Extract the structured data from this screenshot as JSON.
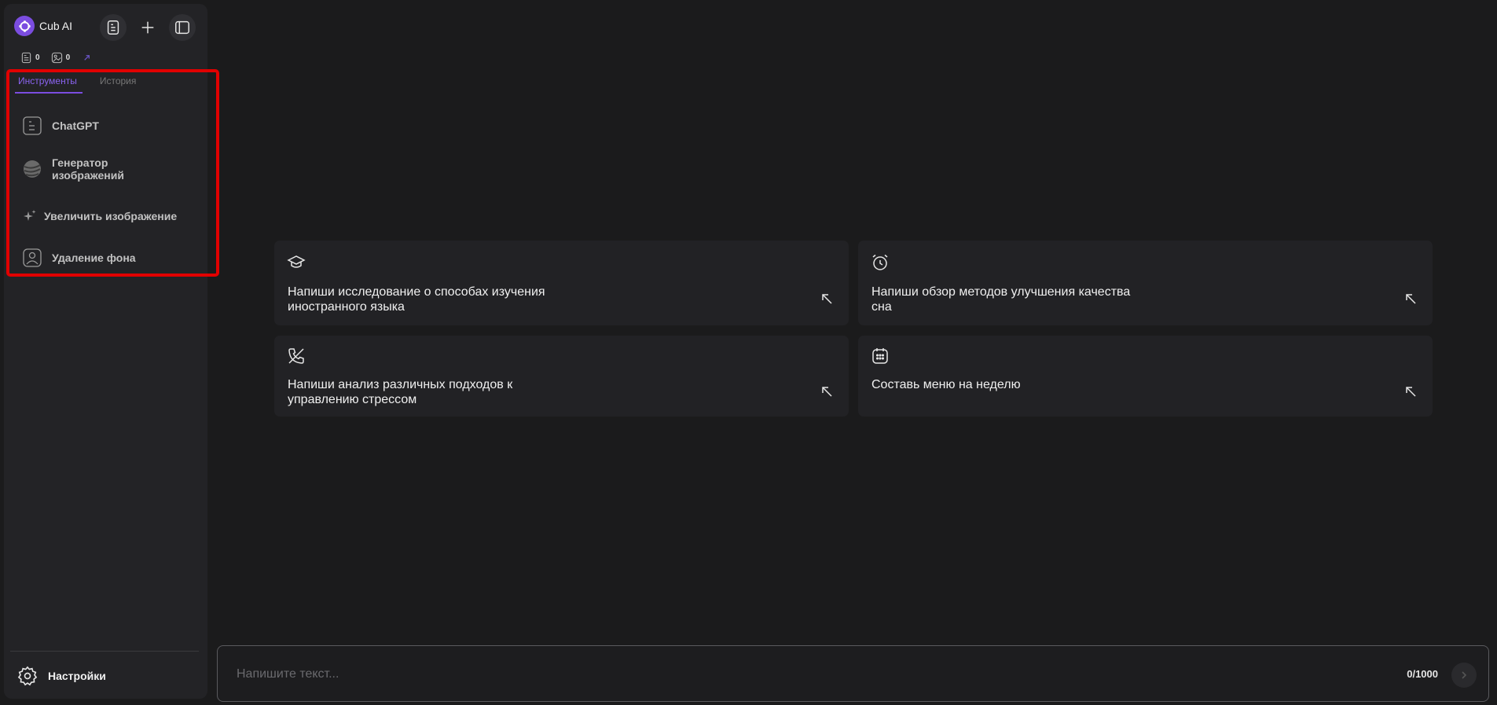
{
  "brand": {
    "name": "Cub AI"
  },
  "counters": [
    {
      "icon": "document-icon",
      "value": "0"
    },
    {
      "icon": "image-icon",
      "value": "0"
    }
  ],
  "tabs": [
    {
      "label": "Инструменты",
      "active": true
    },
    {
      "label": "История",
      "active": false
    }
  ],
  "tools": [
    {
      "label": "ChatGPT",
      "icon": "document-lines-icon"
    },
    {
      "label": "Генератор изображений",
      "icon": "sphere-icon"
    },
    {
      "label": "Увеличить изображение",
      "icon": "sparkle-icon"
    },
    {
      "label": "Удаление фона",
      "icon": "portrait-icon"
    }
  ],
  "settings": {
    "label": "Настройки"
  },
  "cards": [
    {
      "text": "Напиши исследование о способах изучения иностранного языка",
      "icon": "graduation-cap-icon"
    },
    {
      "text": "Напиши обзор методов улучшения качества сна",
      "icon": "alarm-clock-icon"
    },
    {
      "text": "Напиши анализ различных подходов к управлению стрессом",
      "icon": "phone-off-icon"
    },
    {
      "text": "Составь меню на неделю",
      "icon": "calendar-icon"
    }
  ],
  "input": {
    "placeholder": "Напишите текст...",
    "char_count": "0/1000"
  },
  "colors": {
    "accent": "#7b4de0",
    "highlight_border": "#e10000",
    "background": "#1b1b1c",
    "sidebar": "#232326"
  }
}
